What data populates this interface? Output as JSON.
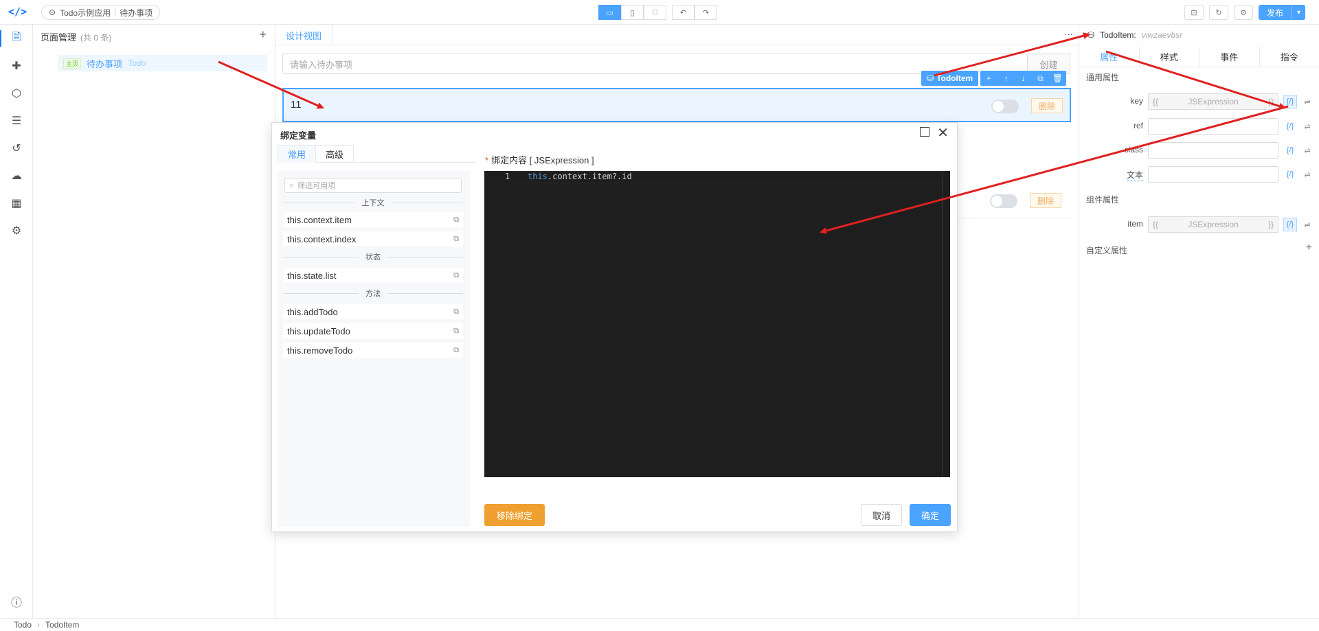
{
  "app": {
    "name": "Todo示例应用",
    "page": "待办事项"
  },
  "topbar": {
    "publish_label": "发布"
  },
  "pages_panel": {
    "title": "页面管理",
    "count": "(共 0 条)",
    "items": [
      {
        "tag": "主页",
        "name": "待办事项",
        "alias": "Todo"
      }
    ]
  },
  "canvas": {
    "tab": "设计视图",
    "input_placeholder": "请输入待办事项",
    "create_label": "创建",
    "rows": [
      {
        "text": "11",
        "delete_label": "删除"
      },
      {
        "text": "",
        "delete_label": "删除"
      }
    ],
    "selection_label": "TodoItem"
  },
  "props": {
    "component": "TodoItem:",
    "component_id": "viwzaevbsr",
    "tabs": [
      "属性",
      "样式",
      "事件",
      "指令"
    ],
    "common_title": "通用属性",
    "common": [
      {
        "label": "key",
        "value": "JSExpression",
        "open": "{{",
        "close": "}}",
        "expr": true
      },
      {
        "label": "ref",
        "value": "",
        "open": "",
        "close": "",
        "expr": false
      },
      {
        "label": "class",
        "value": "",
        "open": "",
        "close": "",
        "expr": false
      },
      {
        "label": "文本",
        "value": "",
        "open": "",
        "close": "",
        "expr": false
      }
    ],
    "component_title": "组件属性",
    "component_props": [
      {
        "label": "item",
        "value": "JSExpression",
        "open": "{{",
        "close": "}}",
        "expr": true
      }
    ],
    "custom_title": "自定义属性"
  },
  "modal": {
    "title": "绑定变量",
    "tabs": [
      "常用",
      "高级"
    ],
    "filter_placeholder": "筛选可用项",
    "groups": [
      {
        "name": "上下文",
        "items": [
          "this.context.item",
          "this.context.index"
        ]
      },
      {
        "name": "状态",
        "items": [
          "this.state.list"
        ]
      },
      {
        "name": "方法",
        "items": [
          "this.addTodo",
          "this.updateTodo",
          "this.removeTodo"
        ]
      }
    ],
    "bind_label": "绑定内容 [ JSExpression ]",
    "code_line_no": "1",
    "code_keyword": "this",
    "code_rest": ".context.item?.id",
    "remove_label": "移除绑定",
    "cancel_label": "取消",
    "ok_label": "确定"
  },
  "statusbar": {
    "path": [
      "Todo",
      "TodoItem"
    ]
  },
  "colors": {
    "accent": "#4aa3ff",
    "warning": "#f0a030",
    "annotation_arrow": "#e02020",
    "editor_bg": "#1e1e1e"
  }
}
